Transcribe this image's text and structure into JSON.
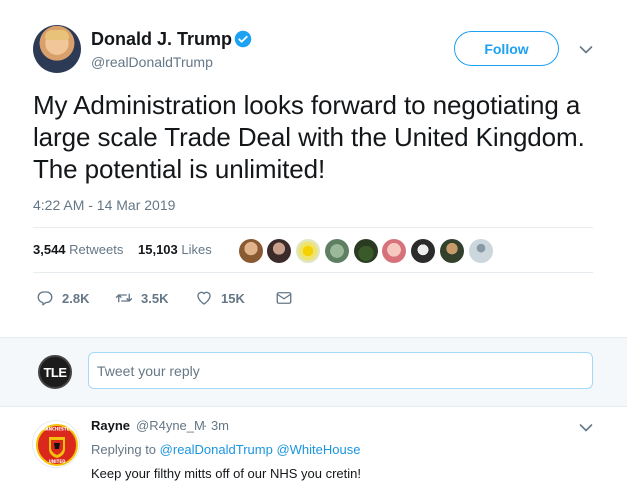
{
  "tweet": {
    "author": {
      "display_name": "Donald J. Trump",
      "handle": "@realDonaldTrump",
      "verified_icon": "verified-badge"
    },
    "follow_label": "Follow",
    "text": "My Administration looks forward to negotiating a large scale Trade Deal with the United Kingdom. The potential is unlimited!",
    "timestamp": "4:22 AM - 14 Mar 2019",
    "stats": {
      "retweets_count": "3,544",
      "retweets_label": "Retweets",
      "likes_count": "15,103",
      "likes_label": "Likes"
    },
    "actions": {
      "reply_count": "2.8K",
      "retweet_count": "3.5K",
      "like_count": "15K"
    }
  },
  "compose": {
    "placeholder": "Tweet your reply",
    "avatar_text": "TLE"
  },
  "reply": {
    "display_name": "Rayne",
    "handle": "@R4yne_M",
    "time": "· 3m",
    "replying_prefix": "Replying to",
    "mentions": [
      "@realDonaldTrump",
      "@WhiteHouse"
    ],
    "text": "Keep your filthy mitts off of our NHS you cretin!",
    "avatar_badge_text": "MANCHESTER UNITED"
  },
  "colors": {
    "accent": "#1da1f2",
    "muted": "#657786",
    "text": "#14171a",
    "border": "#e6ecf0"
  }
}
